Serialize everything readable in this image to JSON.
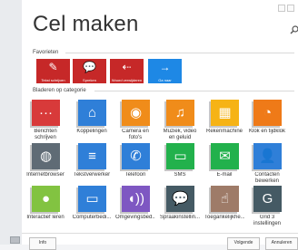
{
  "title": "Cel maken",
  "favorites": {
    "label": "Favorieten",
    "items": [
      {
        "label": "Tekst schrijven",
        "glyph": "✎",
        "color": "#c62828"
      },
      {
        "label": "Spreken",
        "glyph": "💬",
        "color": "#c62828"
      },
      {
        "label": "Woord verwijderen",
        "glyph": "⇠",
        "color": "#c62828"
      },
      {
        "label": "Ga naar",
        "glyph": "→",
        "color": "#1e88e5"
      }
    ]
  },
  "categories": {
    "label": "Bladeren op categorie",
    "apps": [
      {
        "label": "Berichten schrijven",
        "glyph": "···",
        "color": "#d83a3a"
      },
      {
        "label": "Koppelingen",
        "glyph": "⌂",
        "color": "#2f7fd8"
      },
      {
        "label": "Camera en foto's",
        "glyph": "◉",
        "color": "#f08c1a"
      },
      {
        "label": "Muziek, video en geluid",
        "glyph": "♫",
        "color": "#f08c1a"
      },
      {
        "label": "Rekenmachine",
        "glyph": "▦",
        "color": "#f6b315"
      },
      {
        "label": "Klok en tijdklok",
        "glyph": "◔",
        "color": "#ef7a18"
      },
      {
        "label": "Internetbrowser",
        "glyph": "◍",
        "color": "#5f6b75"
      },
      {
        "label": "Tekstverwerker",
        "glyph": "≡",
        "color": "#2f7fd8"
      },
      {
        "label": "Telefoon",
        "glyph": "✆",
        "color": "#2f7fd8"
      },
      {
        "label": "SMS",
        "glyph": "▭",
        "color": "#22b14c"
      },
      {
        "label": "E-mail",
        "glyph": "✉",
        "color": "#22b14c"
      },
      {
        "label": "Contacten bewerken",
        "glyph": "👤",
        "color": "#2f7fd8"
      },
      {
        "label": "Interactief leren",
        "glyph": "●",
        "color": "#82c341"
      },
      {
        "label": "Computerbedi...",
        "glyph": "▭",
        "color": "#2f7fd8"
      },
      {
        "label": "Omgevingsbed...",
        "glyph": "◖))",
        "color": "#7e57c2"
      },
      {
        "label": "Spraakinstellin...",
        "glyph": "💬",
        "color": "#455a64"
      },
      {
        "label": "Toegankelijkhe...",
        "glyph": "☝",
        "color": "#9e7b68"
      },
      {
        "label": "Grid 3 instellingen",
        "glyph": "G",
        "color": "#455a64"
      }
    ]
  },
  "footer": {
    "info_label": "Info",
    "next_label": "Volgende",
    "cancel_label": "Annuleren"
  }
}
